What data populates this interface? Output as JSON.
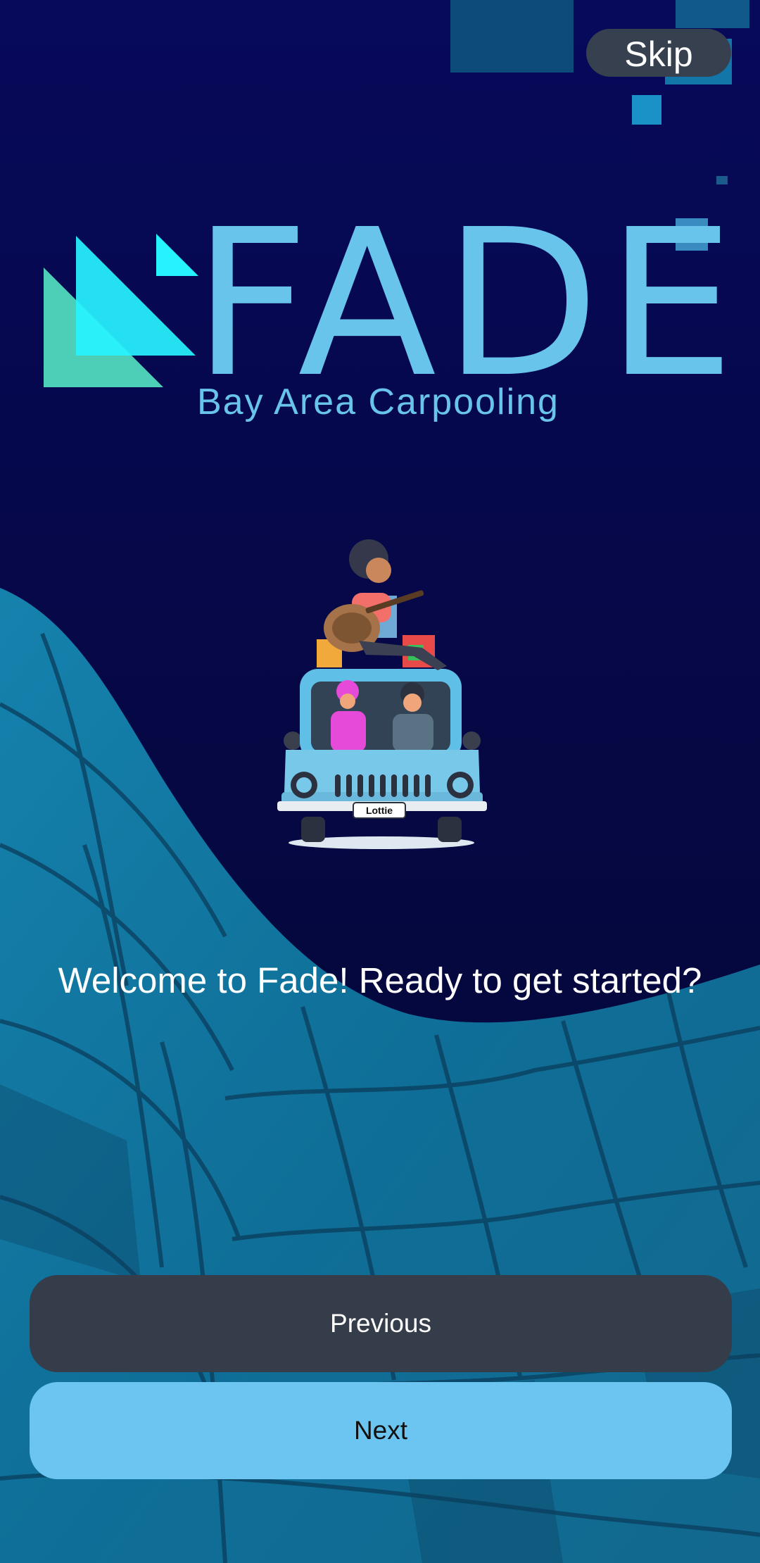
{
  "colors": {
    "background": "#060a52",
    "wave_blue": "#1a7aa6",
    "logo_blue": "#69c4ec",
    "logo_cyan": "#27f3ff",
    "logo_teal": "#4ccfb6",
    "skip_bg": "#37404f",
    "previous_bg": "#353c4a",
    "next_bg": "#6bc5f0"
  },
  "header": {
    "skip_label": "Skip"
  },
  "logo": {
    "icon": "triangles-logo-icon",
    "wordmark": "FADE",
    "tagline": "Bay Area Carpooling"
  },
  "illustration": {
    "icon": "carpool-car-illustration",
    "plate_text": "Lottie"
  },
  "main": {
    "welcome_text": "Welcome to Fade! Ready to get started?"
  },
  "nav": {
    "previous_label": "Previous",
    "next_label": "Next"
  }
}
